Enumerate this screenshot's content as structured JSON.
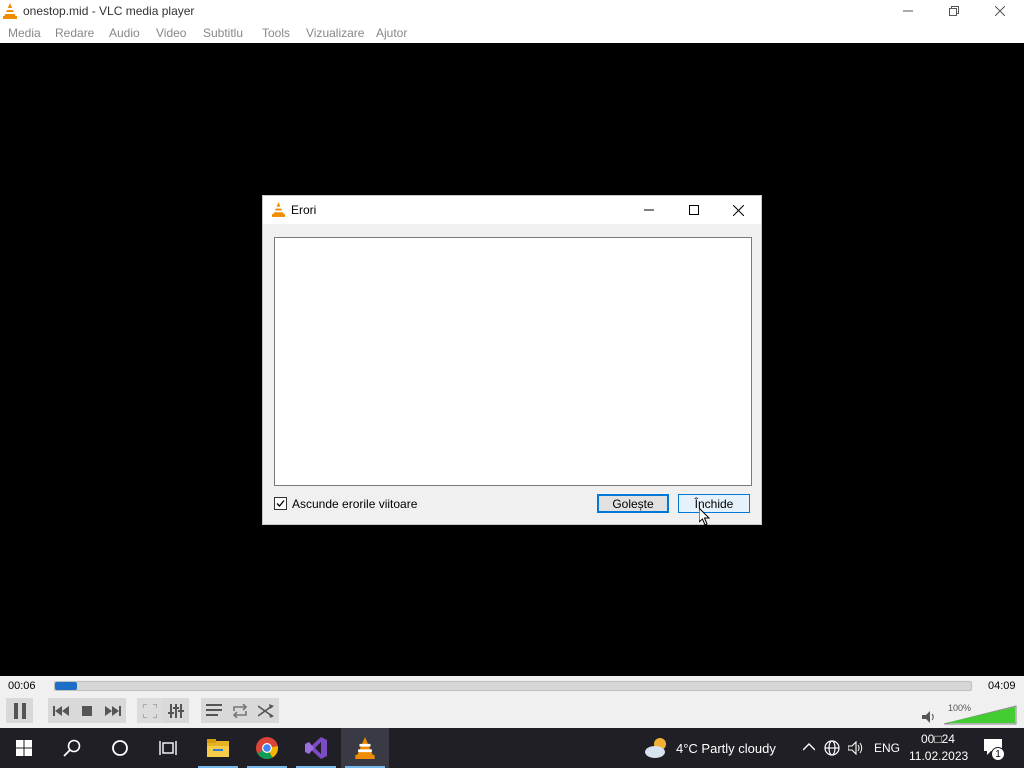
{
  "window": {
    "title": "onestop.mid - VLC media player"
  },
  "menu": [
    "Media",
    "Redare",
    "Audio",
    "Video",
    "Subtitlu",
    "Tools",
    "Vizualizare",
    "Ajutor"
  ],
  "dialog": {
    "title": "Erori",
    "errors_text": "",
    "hide_future_errors_label": "Ascunde erorile viitoare",
    "hide_future_errors_checked": true,
    "clear_button": "Golește",
    "close_button": "Închide"
  },
  "player": {
    "elapsed": "00:06",
    "total": "04:09",
    "progress_fraction": 0.024,
    "volume_label": "100%",
    "volume_fraction": 1.0
  },
  "taskbar": {
    "weather_temp_text": "4°C  Partly cloudy",
    "language": "ENG",
    "clock_time": "00□24",
    "clock_date": "11.02.2023",
    "notifications_count": "1",
    "icons": [
      "windows-start-icon",
      "search-icon",
      "cortana-icon",
      "task-view-icon",
      "file-explorer-icon",
      "chrome-icon",
      "visual-studio-icon",
      "vlc-icon"
    ]
  },
  "colors": {
    "accent": "#0078d7",
    "seek_fill": "#1c6fc6",
    "vlc_orange": "#f08c00",
    "taskbar_bg": "#1f1f25"
  }
}
